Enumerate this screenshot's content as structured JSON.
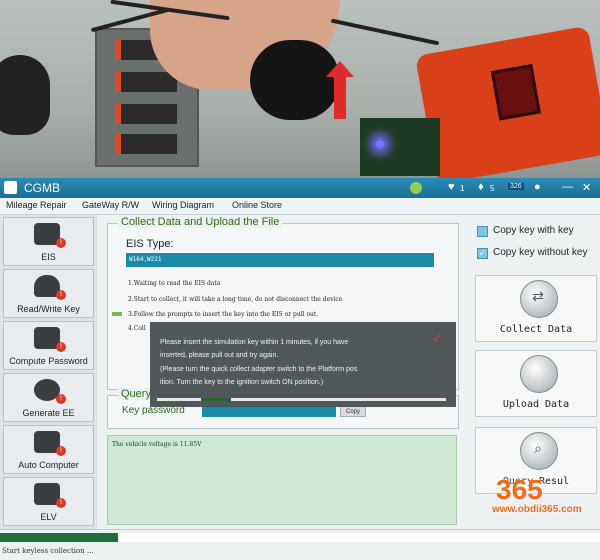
{
  "app": {
    "title": "CGMB"
  },
  "title_icons": {
    "notif_count": "1",
    "msg_count": "5",
    "badge_text": "326"
  },
  "menu": [
    "Mileage Repair",
    "GateWay R/W",
    "Wiring Diagram",
    "Online Store"
  ],
  "sidebar": [
    {
      "label": "EIS",
      "badge": "!"
    },
    {
      "label": "Read/Write Key",
      "badge": "!"
    },
    {
      "label": "Compute Password",
      "badge": "!"
    },
    {
      "label": "Generate EE",
      "badge": "!"
    },
    {
      "label": "Auto Computer",
      "badge": "!"
    },
    {
      "label": "ELV",
      "badge": "!"
    }
  ],
  "collect_panel": {
    "legend": "Collect Data and Upload the File",
    "eis_type_label": "EIS Type:",
    "eis_type_value": "W164,W221",
    "steps": [
      "1.Waiting to read the EIS data",
      "2.Start to collect, it will take a long time, do not disconnect the device",
      "3.Follow the prompts to insert the key into the EIS or pull out.",
      "4.Coll"
    ]
  },
  "query_panel": {
    "legend": "Query",
    "key_password_label": "Key password",
    "copy_label": "Copy"
  },
  "log": {
    "line": "The vehicle voltage is 11.85V"
  },
  "dialog": {
    "lines": [
      "Please insert the simulation key within 1 minutes, if you have",
      "inserted, please pull out and try again.",
      "(Please turn the quick collect adapter switch to the Platform pos",
      "ition. Turn the key to the ignition switch ON position.)"
    ],
    "progress": 0.1
  },
  "right_panel": {
    "checks": [
      {
        "label": "Copy key with key",
        "checked": false
      },
      {
        "label": "Copy key without key",
        "checked": true
      }
    ],
    "buttons": [
      "Collect Data",
      "Upload Data",
      "Query Resul"
    ]
  },
  "watermark": {
    "number": "365",
    "site": "www.obdii365.com"
  },
  "status": {
    "text": "Start keyless collection ...",
    "progress": 0.2
  },
  "colors": {
    "accent": "#1a8ba6",
    "title_bar": "#1b6e96",
    "legend_green": "#2a6b16"
  }
}
